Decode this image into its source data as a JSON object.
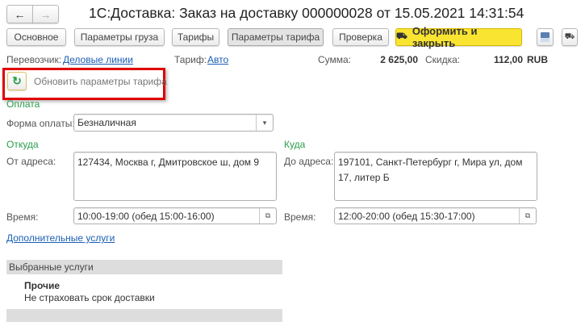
{
  "window": {
    "title": "1С:Доставка: Заказ на доставку 000000028 от 15.05.2021 14:31:54"
  },
  "nav": {
    "back_icon": "arrow-left-icon",
    "forward_icon": "arrow-right-icon"
  },
  "toolbar": {
    "tabs": [
      {
        "label": "Основное"
      },
      {
        "label": "Параметры груза"
      },
      {
        "label": "Тарифы"
      },
      {
        "label": "Параметры тарифа",
        "active": true
      },
      {
        "label": "Проверка"
      }
    ],
    "submit_label": "Оформить и закрыть",
    "submit_icon": "delivery-truck-icon",
    "save_icon": "floppy-disk-icon",
    "more_icon": "delivery-truck-icon",
    "accent": "#f9e431"
  },
  "summary": {
    "carrier_label": "Перевозчик:",
    "carrier": "Деловые линии",
    "tariff_label": "Тариф:",
    "tariff": "Авто",
    "sum_label": "Сумма:",
    "sum": "2 625,00",
    "discount_label": "Скидка:",
    "discount": "112,00",
    "currency": "RUB"
  },
  "refresh": {
    "icon": "refresh-icon",
    "label": "Обновить параметры тарифа",
    "highlight_color": "#e00000"
  },
  "payment": {
    "section": "Оплата",
    "form_label": "Форма оплаты:",
    "form_value": "Безналичная"
  },
  "from": {
    "section": "Откуда",
    "address_label": "От адреса:",
    "address": "127434, Москва г, Дмитровское ш, дом 9",
    "time_label": "Время:",
    "time": "10:00-19:00 (обед 15:00-16:00)"
  },
  "to": {
    "section": "Куда",
    "address_label": "До адреса:",
    "address": "197101, Санкт-Петербург г, Мира ул, дом 17, литер Б",
    "time_label": "Время:",
    "time": "12:00-20:00 (обед 15:30-17:00)"
  },
  "extra_link": "Дополнительные услуги",
  "services": {
    "header": "Выбранные услуги",
    "group": "Прочие",
    "item": "Не страховать срок доставки"
  }
}
